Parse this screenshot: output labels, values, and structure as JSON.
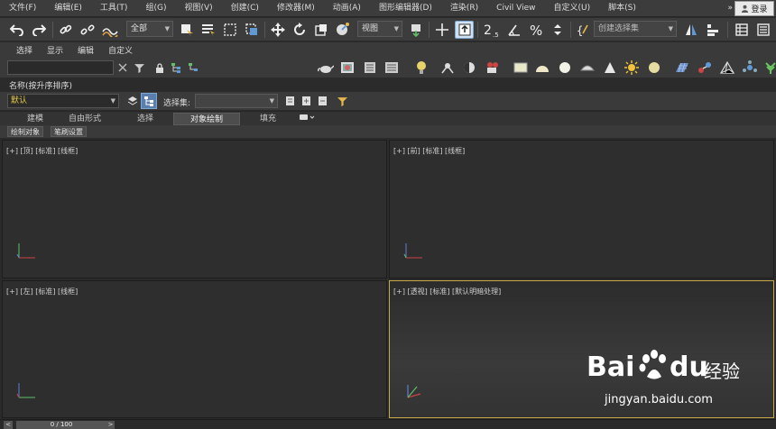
{
  "menubar": {
    "items": [
      "文件(F)",
      "编辑(E)",
      "工具(T)",
      "组(G)",
      "视图(V)",
      "创建(C)",
      "修改器(M)",
      "动画(A)",
      "图形编辑器(D)",
      "渲染(R)",
      "Civil View",
      "自定义(U)",
      "脚本(S)"
    ],
    "more": "»",
    "login": "登录"
  },
  "toolbar": {
    "filter_value": "全部",
    "refcoord_value": "视图",
    "named_selection_placeholder": "创建选择集"
  },
  "ribbon_menu": [
    "选择",
    "显示",
    "编辑",
    "自定义"
  ],
  "scene_explorer": {
    "search_value": "",
    "name_column": "名称(按升序排序)",
    "layer_value": "默认",
    "selection_set_label": "选择集:",
    "selection_set_value": ""
  },
  "modeling_tabs": [
    "建模",
    "自由形式",
    "选择",
    "对象绘制",
    "填充"
  ],
  "active_tab": "对象绘制",
  "sub_tabs": [
    "绘制对象",
    "笔刷设置"
  ],
  "viewports": [
    {
      "label": "[+] [顶] [标准] [线框]"
    },
    {
      "label": "[+] [前] [标准] [线框]"
    },
    {
      "label": "[+] [左] [标准] [线框]"
    },
    {
      "label": "[+] [透视] [标准] [默认明暗处理]"
    }
  ],
  "timeline": {
    "position": "0 / 100",
    "prev": "<",
    "next": ">"
  },
  "watermark": {
    "brand": "Bai",
    "brand_suffix": "du",
    "cn": "经验",
    "url": "jingyan.baidu.com"
  },
  "colors": {
    "active_viewport_border": "#c9a84a",
    "layer_text": "#e6c84a"
  }
}
